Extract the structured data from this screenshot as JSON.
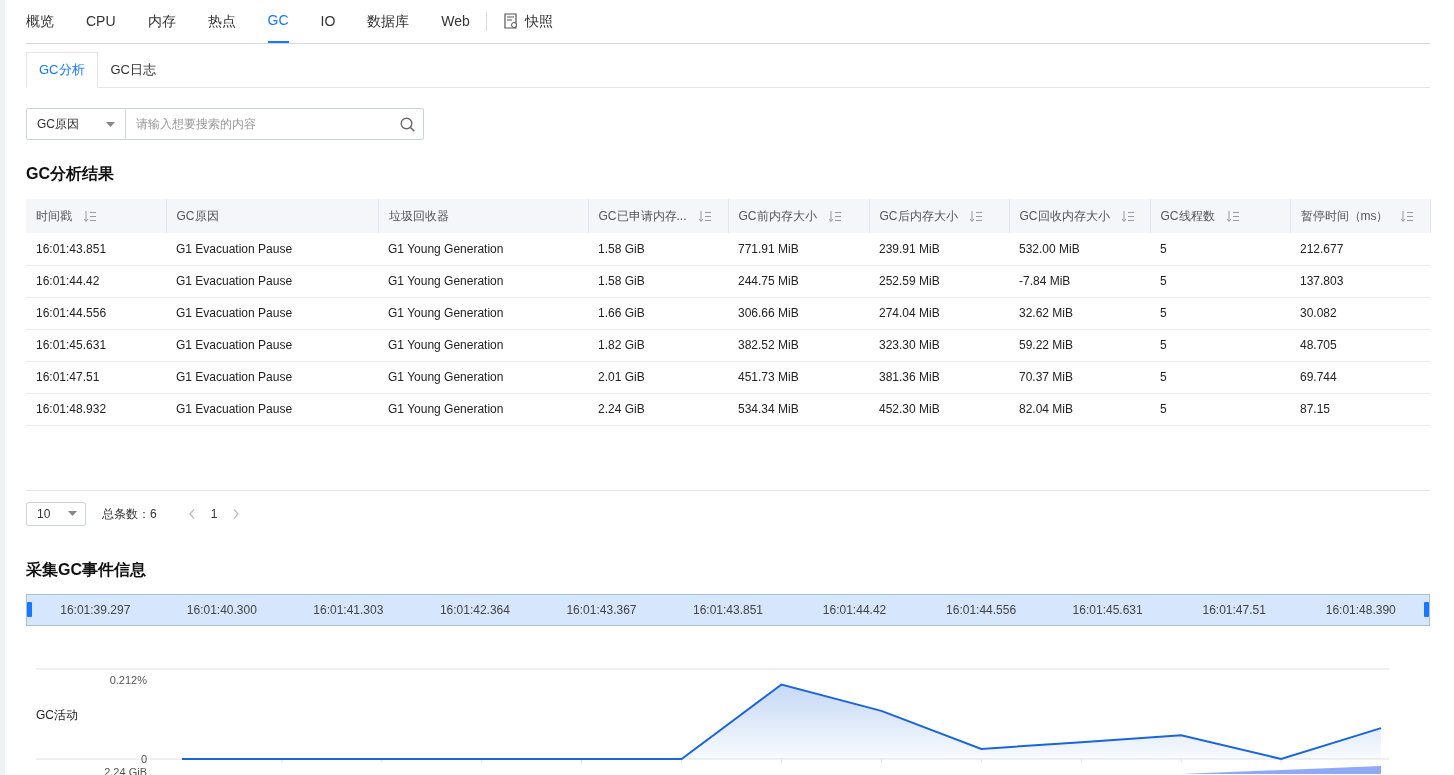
{
  "nav_tabs": [
    {
      "label": "概览",
      "selected": false
    },
    {
      "label": "CPU",
      "selected": false
    },
    {
      "label": "内存",
      "selected": false
    },
    {
      "label": "热点",
      "selected": false
    },
    {
      "label": "GC",
      "selected": true
    },
    {
      "label": "IO",
      "selected": false
    },
    {
      "label": "数据库",
      "selected": false
    },
    {
      "label": "Web",
      "selected": false
    },
    {
      "label": "快照",
      "selected": false,
      "kind": "snapshot"
    }
  ],
  "sub_tabs": [
    {
      "label": "GC分析",
      "selected": true
    },
    {
      "label": "GC日志",
      "selected": false
    }
  ],
  "search": {
    "filter": "GC原因",
    "placeholder": "请输入想要搜索的内容"
  },
  "results": {
    "title": "GC分析结果",
    "columns": [
      {
        "label": "时间戳",
        "sortable": true
      },
      {
        "label": "GC原因",
        "sortable": false
      },
      {
        "label": "垃圾回收器",
        "sortable": false
      },
      {
        "label": "GC已申请内存...",
        "sortable": true
      },
      {
        "label": "GC前内存大小",
        "sortable": true
      },
      {
        "label": "GC后内存大小",
        "sortable": true
      },
      {
        "label": "GC回收内存大小",
        "sortable": true
      },
      {
        "label": "GC线程数",
        "sortable": true
      },
      {
        "label": "暂停时间（ms）",
        "sortable": true
      }
    ],
    "rows": [
      [
        "16:01:43.851",
        "G1 Evacuation Pause",
        "G1 Young Generation",
        "1.58 GiB",
        "771.91 MiB",
        "239.91 MiB",
        "532.00 MiB",
        "5",
        "212.677"
      ],
      [
        "16:01:44.42",
        "G1 Evacuation Pause",
        "G1 Young Generation",
        "1.58 GiB",
        "244.75 MiB",
        "252.59 MiB",
        "-7.84 MiB",
        "5",
        "137.803"
      ],
      [
        "16:01:44.556",
        "G1 Evacuation Pause",
        "G1 Young Generation",
        "1.66 GiB",
        "306.66 MiB",
        "274.04 MiB",
        "32.62 MiB",
        "5",
        "30.082"
      ],
      [
        "16:01:45.631",
        "G1 Evacuation Pause",
        "G1 Young Generation",
        "1.82 GiB",
        "382.52 MiB",
        "323.30 MiB",
        "59.22 MiB",
        "5",
        "48.705"
      ],
      [
        "16:01:47.51",
        "G1 Evacuation Pause",
        "G1 Young Generation",
        "2.01 GiB",
        "451.73 MiB",
        "381.36 MiB",
        "70.37 MiB",
        "5",
        "69.744"
      ],
      [
        "16:01:48.932",
        "G1 Evacuation Pause",
        "G1 Young Generation",
        "2.24 GiB",
        "534.34 MiB",
        "452.30 MiB",
        "82.04 MiB",
        "5",
        "87.15"
      ]
    ]
  },
  "pagination": {
    "page_size": "10",
    "total": "总条数：6",
    "page": "1"
  },
  "events": {
    "title": "采集GC事件信息",
    "timeline": [
      "16:01:39.297",
      "16:01:40.300",
      "16:01:41.303",
      "16:01:42.364",
      "16:01:43.367",
      "16:01:43.851",
      "16:01:44.42",
      "16:01:44.556",
      "16:01:45.631",
      "16:01:47.51",
      "16:01:48.390"
    ],
    "chart": {
      "label": "GC活动",
      "chart_data": {
        "type": "area",
        "ylim": [
          0,
          0.212
        ],
        "yticks": [
          {
            "value": 0,
            "label": "0"
          },
          {
            "value": 0.212,
            "label": "0.212%"
          }
        ],
        "series": [
          {
            "color": "#1a66d9",
            "values": [
              0,
              0,
              0,
              0,
              0,
              0,
              0.2,
              0.129,
              0.027,
              0.045,
              0.064,
              0,
              0.083
            ]
          }
        ]
      }
    },
    "next_chart_label": "2.24 GiB"
  }
}
